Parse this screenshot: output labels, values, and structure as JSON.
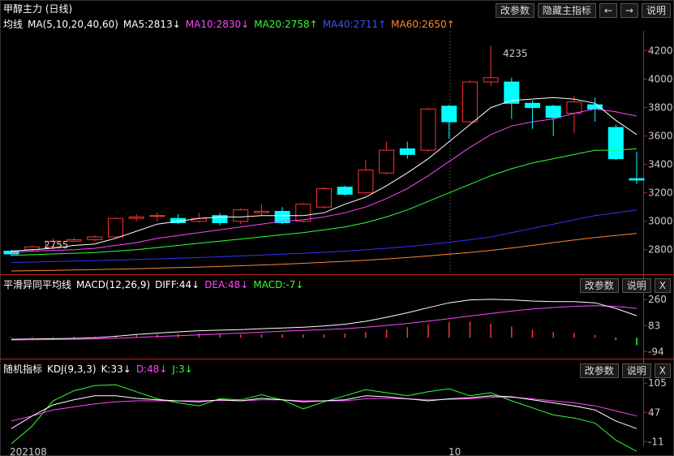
{
  "window": {
    "title": "甲醇主力 (日线)"
  },
  "top_buttons": {
    "params": "改参数",
    "hide_main": "隐藏主指标",
    "left": "←",
    "right": "→",
    "help": "说明"
  },
  "main_panel": {
    "title": "均线",
    "ma_spec": "MA(5,10,20,40,60)",
    "ma5": "MA5:2813↓",
    "ma10": "MA10:2830↓",
    "ma20": "MA20:2758↑",
    "ma40": "MA40:2711↑",
    "ma60": "MA60:2650↑",
    "high_label": "4235",
    "low_label": "2755",
    "y_ticks": [
      "4200",
      "4000",
      "3800",
      "3600",
      "3400",
      "3200",
      "3000",
      "2800"
    ]
  },
  "macd_panel": {
    "title": "平滑异同平均线",
    "spec": "MACD(12,26,9)",
    "diff": "DIFF:44↓",
    "dea": "DEA:48↓",
    "macd": "MACD:-7↓",
    "y_ticks": [
      "260",
      "83",
      "-94"
    ],
    "params": "改参数",
    "help": "说明",
    "close": "X"
  },
  "kdj_panel": {
    "title": "随机指标",
    "spec": "KDJ(9,3,3)",
    "k": "K:33↓",
    "d": "D:48↓",
    "j": "J:3↓",
    "y_ticks": [
      "105",
      "47",
      "-11"
    ],
    "params": "改参数",
    "help": "说明",
    "close": "X"
  },
  "x_axis": {
    "labels": [
      "202108",
      "10"
    ]
  },
  "colors": {
    "up": "#ff3333",
    "down": "#00ffff",
    "ma5": "#ffffff",
    "ma10": "#ff44ff",
    "ma20": "#33ff33",
    "ma40": "#3333ff",
    "ma60": "#ff8833"
  },
  "chart_data": {
    "type": "candlestick",
    "candles": [
      {
        "o": 2790,
        "c": 2770,
        "h": 2800,
        "l": 2755
      },
      {
        "o": 2800,
        "c": 2820,
        "h": 2830,
        "l": 2790
      },
      {
        "o": 2820,
        "c": 2860,
        "h": 2880,
        "l": 2810
      },
      {
        "o": 2860,
        "c": 2870,
        "h": 2885,
        "l": 2850
      },
      {
        "o": 2870,
        "c": 2890,
        "h": 2900,
        "l": 2860
      },
      {
        "o": 2890,
        "c": 3020,
        "h": 3030,
        "l": 2880
      },
      {
        "o": 3020,
        "c": 3030,
        "h": 3050,
        "l": 3000
      },
      {
        "o": 3040,
        "c": 3040,
        "h": 3060,
        "l": 3000
      },
      {
        "o": 3020,
        "c": 2990,
        "h": 3050,
        "l": 2980
      },
      {
        "o": 3000,
        "c": 3020,
        "h": 3060,
        "l": 2990
      },
      {
        "o": 3040,
        "c": 2990,
        "h": 3060,
        "l": 2970
      },
      {
        "o": 3000,
        "c": 3080,
        "h": 3090,
        "l": 2980
      },
      {
        "o": 3060,
        "c": 3070,
        "h": 3120,
        "l": 3040
      },
      {
        "o": 3070,
        "c": 2990,
        "h": 3100,
        "l": 2980
      },
      {
        "o": 3000,
        "c": 3120,
        "h": 3130,
        "l": 2990
      },
      {
        "o": 3100,
        "c": 3230,
        "h": 3240,
        "l": 3090
      },
      {
        "o": 3240,
        "c": 3190,
        "h": 3250,
        "l": 3180
      },
      {
        "o": 3200,
        "c": 3360,
        "h": 3430,
        "l": 3190
      },
      {
        "o": 3340,
        "c": 3500,
        "h": 3560,
        "l": 3330
      },
      {
        "o": 3510,
        "c": 3470,
        "h": 3560,
        "l": 3440
      },
      {
        "o": 3500,
        "c": 3790,
        "h": 3800,
        "l": 3490
      },
      {
        "o": 3810,
        "c": 3700,
        "h": 3820,
        "l": 3580
      },
      {
        "o": 3700,
        "c": 3980,
        "h": 3990,
        "l": 3690
      },
      {
        "o": 3980,
        "c": 4010,
        "h": 4235,
        "l": 3950
      },
      {
        "o": 3980,
        "c": 3830,
        "h": 4010,
        "l": 3720
      },
      {
        "o": 3830,
        "c": 3800,
        "h": 3850,
        "l": 3650
      },
      {
        "o": 3810,
        "c": 3730,
        "h": 3820,
        "l": 3600
      },
      {
        "o": 3760,
        "c": 3840,
        "h": 3880,
        "l": 3620
      },
      {
        "o": 3820,
        "c": 3790,
        "h": 3870,
        "l": 3700
      },
      {
        "o": 3660,
        "c": 3440,
        "h": 3680,
        "l": 3430
      },
      {
        "o": 3300,
        "c": 3290,
        "h": 3490,
        "l": 3260
      }
    ],
    "ma5": [
      2790,
      2800,
      2810,
      2830,
      2840,
      2880,
      2930,
      2980,
      3000,
      3020,
      3030,
      3030,
      3040,
      3040,
      3040,
      3060,
      3120,
      3170,
      3250,
      3340,
      3440,
      3560,
      3680,
      3800,
      3850,
      3860,
      3870,
      3860,
      3830,
      3710,
      3610
    ],
    "ma10": [
      2780,
      2790,
      2795,
      2800,
      2810,
      2830,
      2850,
      2880,
      2900,
      2920,
      2940,
      2960,
      2980,
      3000,
      3010,
      3030,
      3060,
      3100,
      3160,
      3230,
      3320,
      3420,
      3520,
      3610,
      3670,
      3700,
      3720,
      3760,
      3790,
      3770,
      3740
    ],
    "ma20": [
      2760,
      2765,
      2770,
      2775,
      2780,
      2790,
      2800,
      2815,
      2830,
      2845,
      2860,
      2875,
      2890,
      2905,
      2920,
      2940,
      2960,
      2990,
      3030,
      3080,
      3140,
      3200,
      3260,
      3320,
      3370,
      3410,
      3440,
      3470,
      3500,
      3500,
      3510
    ],
    "ma40": [
      2710,
      2713,
      2716,
      2720,
      2723,
      2727,
      2731,
      2735,
      2740,
      2745,
      2750,
      2756,
      2762,
      2768,
      2775,
      2782,
      2790,
      2800,
      2810,
      2822,
      2836,
      2852,
      2870,
      2890,
      2920,
      2950,
      2980,
      3010,
      3040,
      3060,
      3080
    ],
    "ma60": [
      2650,
      2652,
      2654,
      2657,
      2660,
      2663,
      2666,
      2670,
      2674,
      2678,
      2682,
      2687,
      2692,
      2698,
      2704,
      2711,
      2718,
      2726,
      2735,
      2745,
      2756,
      2768,
      2781,
      2795,
      2812,
      2830,
      2850,
      2868,
      2886,
      2900,
      2915
    ],
    "ylim": [
      2650,
      4300
    ],
    "macd_diff": [
      -10,
      -8,
      -6,
      -4,
      0,
      10,
      22,
      32,
      40,
      48,
      52,
      56,
      62,
      66,
      72,
      80,
      92,
      112,
      140,
      170,
      205,
      238,
      258,
      262,
      258,
      250,
      246,
      246,
      238,
      200,
      150
    ],
    "macd_dea": [
      -15,
      -14,
      -12,
      -10,
      -8,
      -4,
      2,
      8,
      14,
      20,
      26,
      32,
      38,
      44,
      50,
      56,
      62,
      72,
      84,
      98,
      114,
      130,
      148,
      165,
      182,
      196,
      206,
      214,
      218,
      214,
      200
    ],
    "macd_hist": [
      5,
      6,
      6,
      6,
      8,
      14,
      20,
      24,
      26,
      28,
      26,
      24,
      24,
      22,
      22,
      24,
      30,
      40,
      56,
      72,
      91,
      108,
      110,
      97,
      76,
      54,
      40,
      32,
      20,
      -14,
      -50
    ],
    "macd_ylim": [
      -120,
      300
    ],
    "kdj_k": [
      15,
      40,
      62,
      72,
      80,
      80,
      75,
      72,
      70,
      68,
      72,
      70,
      75,
      72,
      68,
      70,
      72,
      80,
      78,
      74,
      70,
      74,
      76,
      80,
      78,
      72,
      66,
      60,
      52,
      30,
      15
    ],
    "kdj_d": [
      30,
      40,
      52,
      58,
      64,
      68,
      70,
      70,
      70,
      70,
      71,
      70,
      72,
      72,
      70,
      70,
      70,
      74,
      75,
      74,
      72,
      73,
      74,
      77,
      77,
      74,
      70,
      66,
      60,
      50,
      40
    ],
    "kdj_j": [
      -15,
      20,
      70,
      90,
      100,
      102,
      88,
      74,
      66,
      60,
      74,
      72,
      82,
      72,
      54,
      68,
      80,
      92,
      86,
      80,
      88,
      94,
      80,
      86,
      70,
      56,
      42,
      36,
      26,
      -8,
      -30
    ],
    "kdj_ylim": [
      -20,
      115
    ]
  }
}
